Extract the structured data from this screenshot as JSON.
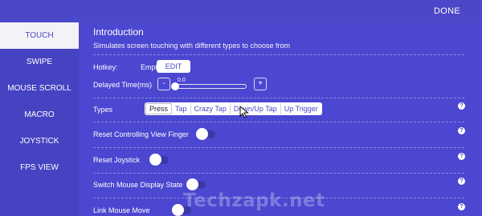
{
  "header": {
    "done_label": "DONE"
  },
  "sidebar": {
    "items": [
      {
        "label": "TOUCH",
        "active": true
      },
      {
        "label": "SWIPE",
        "active": false
      },
      {
        "label": "MOUSE SCROLL",
        "active": false
      },
      {
        "label": "MACRO",
        "active": false
      },
      {
        "label": "JOYSTICK",
        "active": false
      },
      {
        "label": "FPS VIEW",
        "active": false
      }
    ]
  },
  "main": {
    "title": "Introduction",
    "description": "Simulates screen touching with different types to choose from",
    "hotkey": {
      "label": "Hotkey:",
      "value": "Empty",
      "edit_label": "EDIT"
    },
    "delayed_time": {
      "label": "Delayed Time(ms)",
      "minus": "-",
      "plus": "+",
      "value": "0.0",
      "fraction": 0.0
    },
    "types": {
      "label": "Types",
      "options": [
        "Press",
        "Tap",
        "Crazy Tap",
        "Down/Up Tap",
        "Up Trigger"
      ],
      "selected": "Press"
    },
    "reset_view_finger": {
      "label": "Reset Controlling View Finger",
      "on": false
    },
    "reset_joystick": {
      "label": "Reset Joystick",
      "on": false
    },
    "switch_mouse_display": {
      "label": "Switch Mouse Display State",
      "on": false
    },
    "link_mouse_move": {
      "label": "Link Mouse Move",
      "on": false
    },
    "help_symbol": "?"
  },
  "watermark": "Techzapk.net",
  "colors": {
    "background": "#4a47c8",
    "sidebar_active_bg": "#f3f3f7",
    "accent_text": "#4a47c8"
  }
}
